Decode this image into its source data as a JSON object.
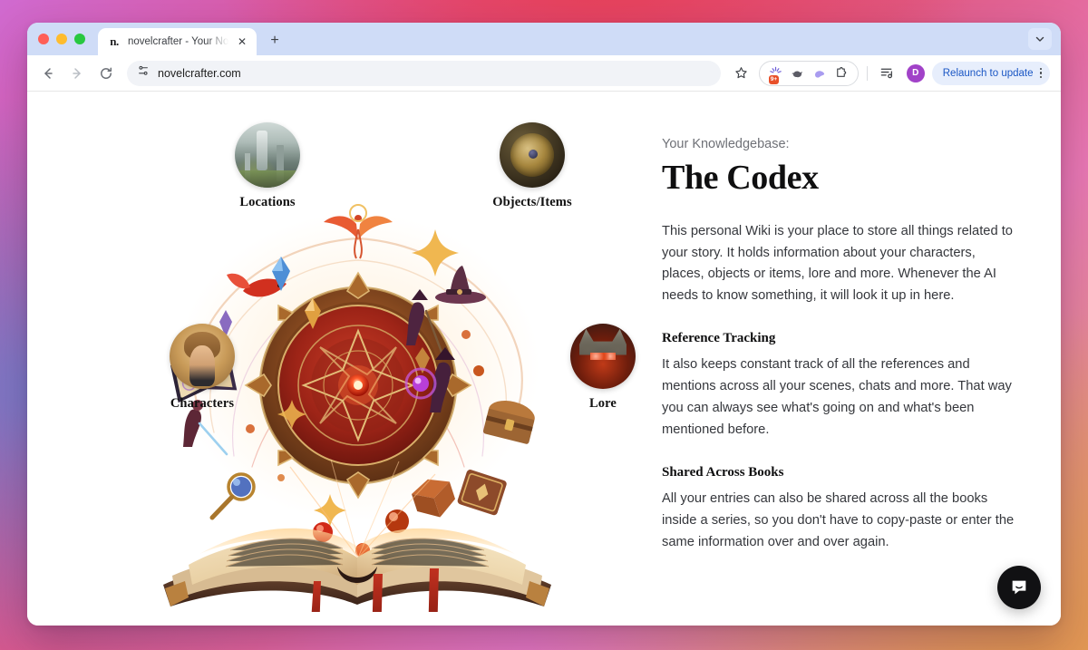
{
  "browser": {
    "tab": {
      "favicon_text": "n.",
      "title": "novelcrafter - Your Novel Writ",
      "close_label": "✕"
    },
    "new_tab_label": "+",
    "toolbar": {
      "back_label": "←",
      "forward_label": "→",
      "reload_label": "⟳",
      "url": "novelcrafter.com",
      "star_label": "☆",
      "avatar_initial": "D",
      "relaunch_label": "Relaunch to update"
    },
    "extensions": [
      {
        "name": "extension-icon-firework",
        "badge": "9+"
      },
      {
        "name": "extension-icon-bird",
        "badge": ""
      },
      {
        "name": "extension-icon-ghost",
        "badge": ""
      },
      {
        "name": "extension-icon-puzzle",
        "badge": ""
      }
    ]
  },
  "page": {
    "categories": [
      {
        "id": "locations",
        "label": "Locations"
      },
      {
        "id": "objects",
        "label": "Objects/Items"
      },
      {
        "id": "characters",
        "label": "Characters"
      },
      {
        "id": "lore",
        "label": "Lore"
      }
    ],
    "copy": {
      "eyebrow": "Your Knowledgebase:",
      "headline": "The Codex",
      "intro": "This personal Wiki is your place to store all things related to your story. It holds information about your characters, places, objects or items, lore and more. Whenever the AI needs to know something, it will look it up in here.",
      "sections": [
        {
          "heading": "Reference Tracking",
          "body": "It also keeps constant track of all the references and mentions across all your scenes, chats and more. That way you can always see what's going on and what's been mentioned before."
        },
        {
          "heading": "Shared Across Books",
          "body": "All your entries can also be shared across all the books inside a series, so you don't have to copy-paste or enter the same information over and over again."
        }
      ]
    },
    "chat_launcher_name": "chat-bubble-icon"
  },
  "colors": {
    "accent_blue": "#1a56c4",
    "avatar_purple": "#a142c8",
    "badge_orange": "#e8502a",
    "tabstrip_blue": "#cfdcf7"
  }
}
